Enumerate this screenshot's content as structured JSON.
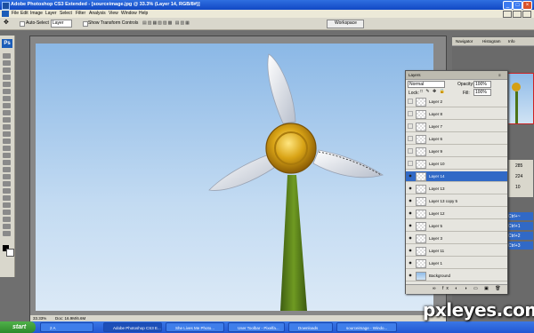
{
  "window": {
    "title": "Adobe Photoshop CS3 Extended - [sourceimage.jpg @ 33.3% (Layer 14, RGB/8#)]"
  },
  "menu": [
    "File",
    "Edit",
    "Image",
    "Layer",
    "Select",
    "Filter",
    "Analysis",
    "View",
    "Window",
    "Help"
  ],
  "options": {
    "auto_select": "Auto-Select",
    "auto_select_target": "Layer",
    "show_transform": "Show Transform Controls",
    "workspace": "Workspace"
  },
  "document": {
    "zoom": "33.33%",
    "doc_size": "Doc: 16.9M/6.6M"
  },
  "right_panels": {
    "navigator_tab": "Navigator",
    "histogram_tab": "Histogram",
    "info_tab": "Info",
    "side_values": [
      "285",
      "224",
      "10"
    ],
    "shortcuts": [
      "Ctrl+~",
      "Ctrl+1",
      "Ctrl+2",
      "Ctrl+3"
    ]
  },
  "layers_panel": {
    "title": "Layers",
    "blend_mode": "Normal",
    "opacity_label": "Opacity:",
    "opacity_value": "100%",
    "lock_label": "Lock:",
    "fill_label": "Fill:",
    "fill_value": "100%",
    "layers": [
      {
        "name": "Layer 2",
        "visible": false,
        "selected": false
      },
      {
        "name": "Layer 8",
        "visible": false,
        "selected": false
      },
      {
        "name": "Layer 7",
        "visible": false,
        "selected": false
      },
      {
        "name": "Layer 6",
        "visible": false,
        "selected": false
      },
      {
        "name": "Layer 9",
        "visible": false,
        "selected": false
      },
      {
        "name": "Layer 10",
        "visible": false,
        "selected": false
      },
      {
        "name": "Layer 14",
        "visible": true,
        "selected": true
      },
      {
        "name": "Layer 13",
        "visible": true,
        "selected": false
      },
      {
        "name": "Layer 13 copy 5",
        "visible": true,
        "selected": false
      },
      {
        "name": "Layer 12",
        "visible": true,
        "selected": false
      },
      {
        "name": "Layer 5",
        "visible": true,
        "selected": false
      },
      {
        "name": "Layer 3",
        "visible": true,
        "selected": false
      },
      {
        "name": "Layer 11",
        "visible": true,
        "selected": false
      },
      {
        "name": "Layer 1",
        "visible": true,
        "selected": false
      },
      {
        "name": "Background",
        "visible": true,
        "selected": false
      }
    ]
  },
  "taskbar": {
    "start": "start",
    "tasks": [
      "2 A",
      "Adobe Photoshop CS3 E...",
      "She Lives Me Photo...",
      "User Toolbar - Pixelfa...",
      "Downloads",
      "sourceimage - Windo..."
    ]
  },
  "watermark": "pxleyes.com"
}
